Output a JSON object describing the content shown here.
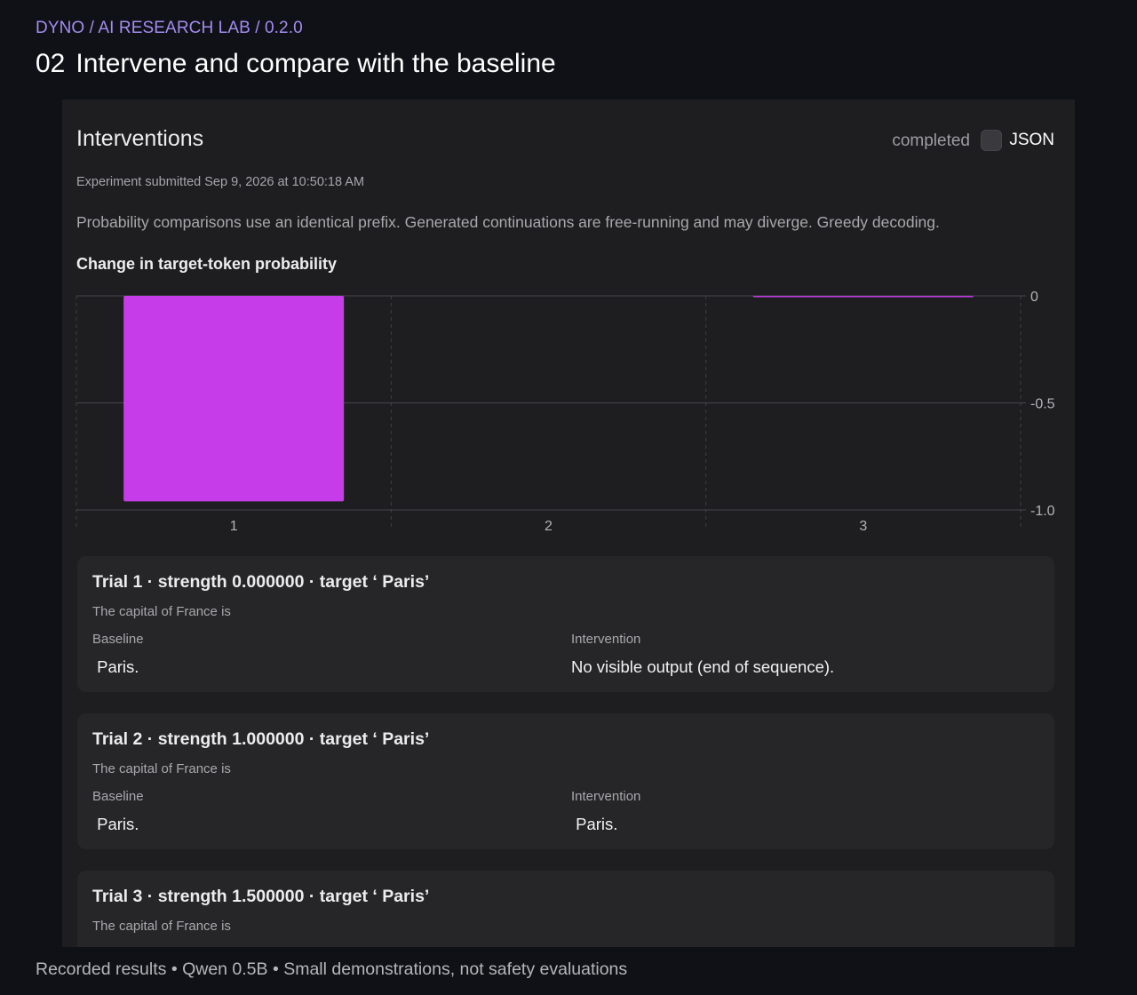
{
  "header": {
    "breadcrumb": "DYNO / AI RESEARCH LAB / 0.2.0",
    "section_number": "02",
    "title": "Intervene and compare with the baseline"
  },
  "panel": {
    "title": "Interventions",
    "status": "completed",
    "json_toggle_label": "JSON",
    "json_toggle_on": false,
    "submitted": "Experiment submitted Sep 9, 2026 at 10:50:18 AM",
    "description": "Probability comparisons use an identical prefix. Generated continuations are free-running and may diverge. Greedy decoding."
  },
  "chart_title": "Change in target-token probability",
  "chart_data": {
    "type": "bar",
    "title": "Change in target-token probability",
    "categories": [
      "1",
      "2",
      "3"
    ],
    "values": [
      -0.96,
      0,
      -0.005
    ],
    "y_ticks": [
      "0",
      "-0.5",
      "-1.0"
    ],
    "ylim": [
      -1.0,
      0
    ],
    "bar_color": "#c63ce8",
    "grid": true,
    "y_axis_side": "right"
  },
  "trials": [
    {
      "title": "Trial 1 · strength 0.000000 · target ‘ Paris’",
      "prompt": "The capital of France is",
      "baseline_label": "Baseline",
      "baseline_value": " Paris.",
      "intervention_label": "Intervention",
      "intervention_value": "No visible output (end of sequence)."
    },
    {
      "title": "Trial 2 · strength 1.000000 · target ‘ Paris’",
      "prompt": "The capital of France is",
      "baseline_label": "Baseline",
      "baseline_value": " Paris.",
      "intervention_label": "Intervention",
      "intervention_value": " Paris."
    },
    {
      "title": "Trial 3 · strength 1.500000 · target ‘ Paris’",
      "prompt": "The capital of France is"
    }
  ],
  "footer": "Recorded results • Qwen 0.5B • Small demonstrations, not safety evaluations"
}
